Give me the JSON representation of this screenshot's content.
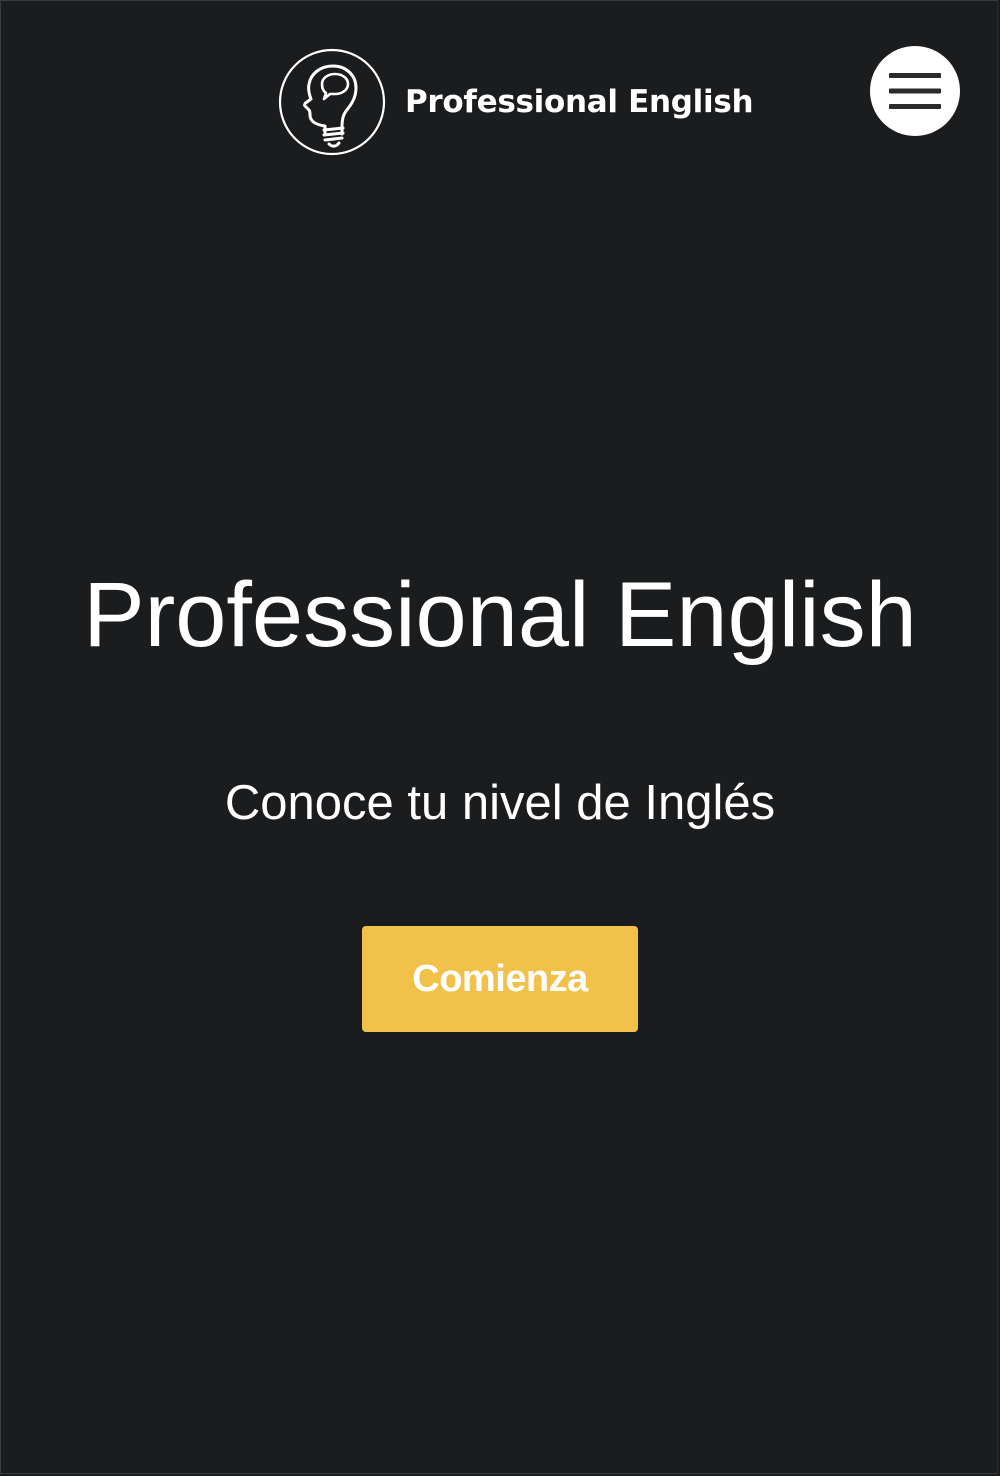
{
  "header": {
    "brand_name": "Professional English",
    "logo_icon": "lightbulb-head-speech-icon",
    "menu_icon": "hamburger-menu-icon"
  },
  "hero": {
    "title": "Professional English",
    "subtitle": "Conoce tu nivel de Inglés",
    "cta_label": "Comienza"
  },
  "colors": {
    "background": "#1b1c1e",
    "text": "#ffffff",
    "accent": "#f2c14a",
    "menu_button": "#ffffff"
  }
}
